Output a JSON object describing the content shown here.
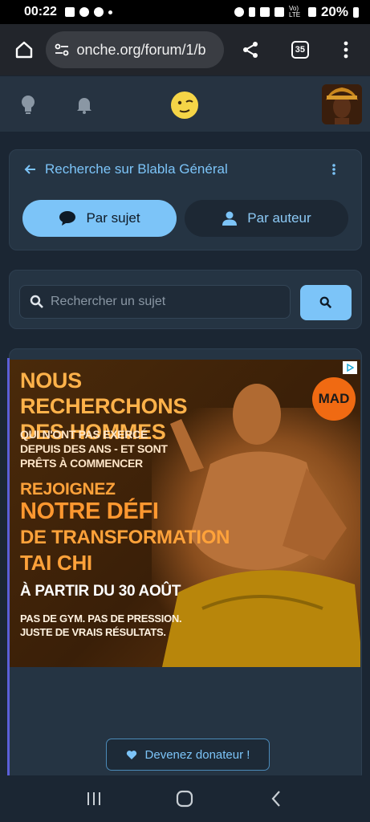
{
  "status_bar": {
    "time": "00:22",
    "battery": "20%",
    "network": "Vo) LTE"
  },
  "browser": {
    "url": "onche.org/forum/1/b",
    "tab_count": "35"
  },
  "header": {
    "icons": [
      "lightbulb-icon",
      "bell-icon",
      "onche-logo",
      "user-avatar"
    ]
  },
  "search_card": {
    "title": "Recherche sur Blabla Général",
    "tabs": [
      {
        "label": "Par sujet",
        "icon": "chat-bubble-icon",
        "active": true
      },
      {
        "label": "Par auteur",
        "icon": "person-icon",
        "active": false
      }
    ]
  },
  "search": {
    "placeholder": "Rechercher un sujet"
  },
  "ad": {
    "headline": "NOUS RECHERCHONS DES HOMMES",
    "subline": "QUI N'ONT PAS EXERCÉ DEPUIS DES ANS - ET SONT PRÊTS À COMMENCER",
    "join": "REJOIGNEZ",
    "defi": "NOTRE DÉFI",
    "transformation": "DE TRANSFORMATION",
    "taichi": "TAI CHI",
    "date": "À PARTIR DU 30 AOÛT",
    "footer": "PAS DE GYM. PAS DE PRESSION. JUSTE DE VRAIS RÉSULTATS.",
    "badge": "MAD"
  },
  "donor": {
    "label": "Devenez donateur !"
  },
  "colors": {
    "accent": "#7cc4f8",
    "background": "#1b2633",
    "card": "#253443",
    "header": "#263341"
  }
}
